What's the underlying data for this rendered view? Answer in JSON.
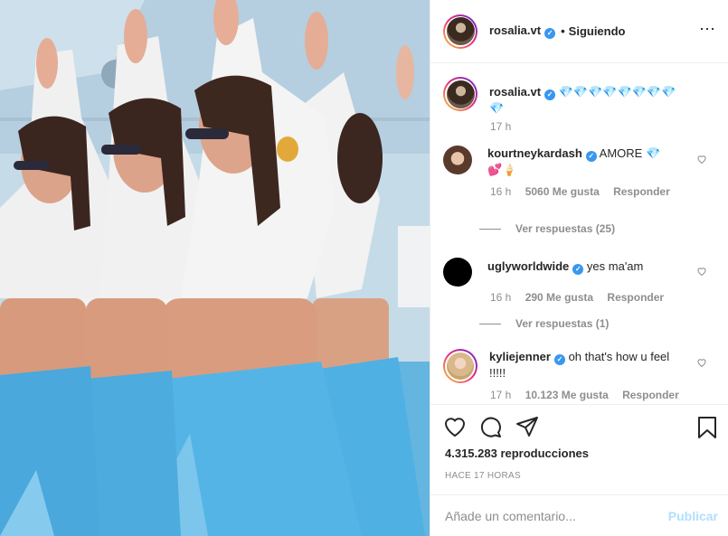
{
  "header": {
    "username": "rosalia.vt",
    "separator": "•",
    "follow_status": "Siguiendo",
    "more_icon": "ellipsis-icon"
  },
  "caption": {
    "username": "rosalia.vt",
    "text": "💎💎💎💎💎💎💎💎💎",
    "time": "17 h"
  },
  "comments": [
    {
      "username": "kourtneykardash",
      "text": "AMORE 💎",
      "text_line2": "💕🍦",
      "time": "16 h",
      "likes": "5060 Me gusta",
      "reply": "Responder",
      "view_replies": "Ver respuestas (25)"
    },
    {
      "username": "uglyworldwide",
      "text": "yes ma'am",
      "time": "16 h",
      "likes": "290 Me gusta",
      "reply": "Responder",
      "view_replies": "Ver respuestas (1)"
    },
    {
      "username": "kyliejenner",
      "text": "oh that's how u feel",
      "text_line2": "!!!!!",
      "time": "17 h",
      "likes": "10.123 Me gusta",
      "reply": "Responder"
    }
  ],
  "actions": {
    "icons": [
      "heart-icon",
      "comment-icon",
      "share-icon",
      "bookmark-icon"
    ],
    "views": "4.315.283 reproducciones",
    "posted": "HACE 17 HORAS"
  },
  "add_comment": {
    "placeholder": "Añade un comentario...",
    "publish": "Publicar"
  },
  "colors": {
    "accent": "#3897f0",
    "publish_disabled": "#b2dffc",
    "muted": "#8e8e8e",
    "text": "#262626"
  }
}
